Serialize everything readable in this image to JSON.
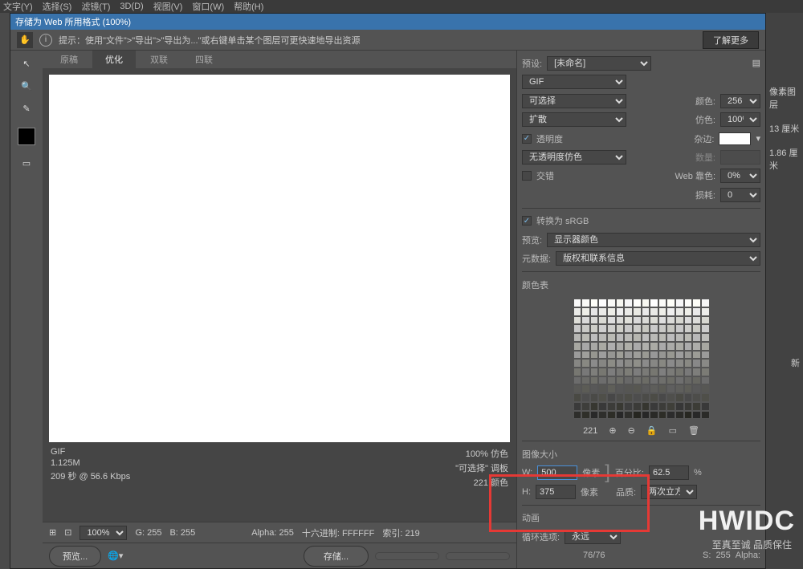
{
  "menubar": {
    "items": [
      "文字(Y)",
      "选择(S)",
      "滤镜(T)",
      "3D(D)",
      "视图(V)",
      "窗口(W)",
      "帮助(H)"
    ]
  },
  "dialog": {
    "title": "存储为 Web 所用格式 (100%)",
    "hint_label": "提示：使用\"文件\">\"导出\">\"导出为...\"或右键单击某个图层可更快速地导出资源",
    "learn_more": "了解更多"
  },
  "tabs": {
    "original": "原稿",
    "optimized": "优化",
    "two_up": "双联",
    "four_up": "四联"
  },
  "info": {
    "format": "GIF",
    "size": "1.125M",
    "time": "209 秒 @ 56.6 Kbps",
    "quality": "100% 仿色",
    "dither": "\"可选择\" 调板",
    "colors": "221 颜色"
  },
  "status": {
    "zoom": "100%",
    "g": "G: 255",
    "b": "B: 255",
    "alpha": "Alpha: 255",
    "hex": "十六进制: FFFFFF",
    "index": "索引: 219"
  },
  "bottom": {
    "preview": "预览...",
    "save": "存储..."
  },
  "panel": {
    "preset_lbl": "预设:",
    "preset_val": "[未命名]",
    "format": "GIF",
    "selective": "可选择",
    "colors_lbl": "颜色:",
    "colors_val": "256",
    "diffusion": "扩散",
    "dither_lbl": "仿色:",
    "dither_val": "100%",
    "transparency": "透明度",
    "matte_lbl": "杂边:",
    "no_trans_dither": "无透明度仿色",
    "amount_lbl": "数量:",
    "interlace": "交错",
    "websnap_lbl": "Web 靠色:",
    "websnap_val": "0%",
    "lossy_lbl": "损耗:",
    "lossy_val": "0",
    "convert_srgb": "转换为 sRGB",
    "preview_lbl": "预览:",
    "preview_val": "显示器颜色",
    "metadata_lbl": "元数据:",
    "metadata_val": "版权和联系信息",
    "colortable_lbl": "颜色表",
    "colortable_count": "221",
    "imagesize_lbl": "图像大小",
    "w_lbl": "W:",
    "w_val": "500",
    "w_unit": "像素",
    "h_lbl": "H:",
    "h_val": "375",
    "h_unit": "像素",
    "percent_lbl": "百分比:",
    "percent_val": "62.5",
    "percent_unit": "%",
    "quality_lbl": "品质:",
    "quality_val": "两次立方",
    "anim_lbl": "动画",
    "loop_lbl": "循环选项:",
    "loop_val": "永远",
    "frame": "76/76",
    "s_lbl": "S:",
    "s_val": "255",
    "alpha_lbl": "Alpha:"
  },
  "bg": {
    "pixel": "像素图层",
    "cm1": "13 厘米",
    "cm2": "1.86 厘米",
    "new": "新"
  },
  "watermark": "HWIDC",
  "watermark2": "至真至诚 品质保住"
}
